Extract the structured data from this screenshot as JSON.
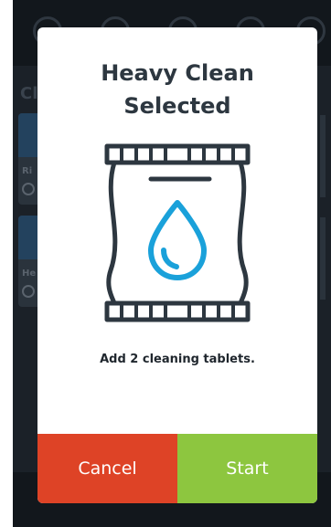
{
  "background": {
    "section_title": "Cl",
    "cards": [
      {
        "label": "Ri"
      },
      {
        "label": "He"
      }
    ]
  },
  "modal": {
    "title_line1": "Heavy Clean",
    "title_line2": "Selected",
    "icon": "cleaning-tablet-pack-icon",
    "instruction": "Add 2 cleaning tablets.",
    "cancel_label": "Cancel",
    "start_label": "Start"
  },
  "colors": {
    "cancel": "#de4326",
    "start": "#8dc63f",
    "icon_outline": "#2d3740",
    "drop": "#1aa1da"
  }
}
